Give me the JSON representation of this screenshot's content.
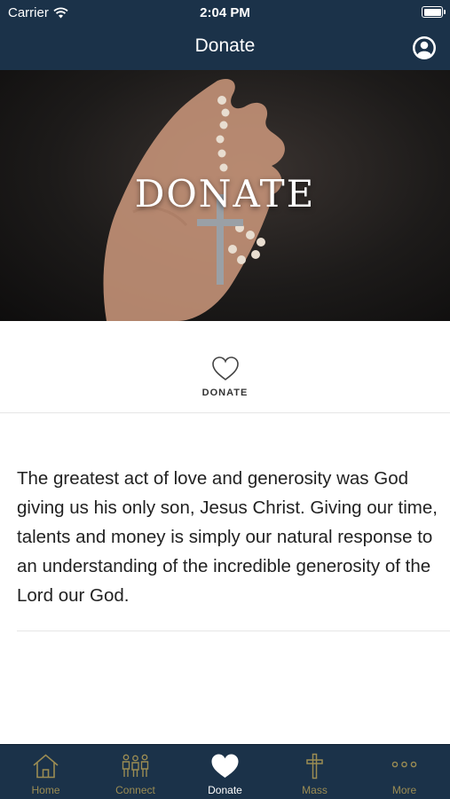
{
  "status_bar": {
    "carrier": "Carrier",
    "time": "2:04 PM"
  },
  "nav": {
    "title": "Donate"
  },
  "hero": {
    "title": "DONATE"
  },
  "donate_button": {
    "label": "DONATE"
  },
  "body": {
    "text": "The greatest act of love and generosity was God giving us his only son, Jesus Christ. Giving our time, talents and money is simply our natural response to an understanding of the incredible generosity of the Lord our God."
  },
  "tabs": [
    {
      "label": "Home",
      "icon": "home-icon"
    },
    {
      "label": "Connect",
      "icon": "people-icon"
    },
    {
      "label": "Donate",
      "icon": "heart-icon"
    },
    {
      "label": "Mass",
      "icon": "cross-icon"
    },
    {
      "label": "More",
      "icon": "more-icon"
    }
  ],
  "colors": {
    "bar": "#1b3249",
    "tab_inactive": "#9b8c53",
    "tab_active": "#ffffff"
  }
}
